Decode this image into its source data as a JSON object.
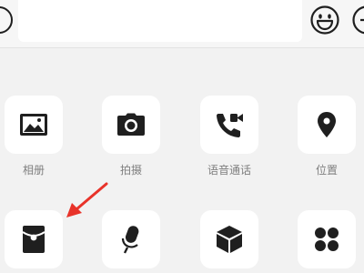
{
  "colors": {
    "panel_bg": "#f2f2f2",
    "tile_bg": "#ffffff",
    "icon": "#1f1f1f",
    "label": "#7f7f7f",
    "arrow": "#e8332a"
  },
  "input_bar": {
    "left_icon": "circle-icon",
    "message_input_value": "",
    "emoji_icon": "emoji-icon",
    "plus_icon": "plus-icon"
  },
  "actions": [
    {
      "icon": "photo-icon",
      "label": "相册"
    },
    {
      "icon": "camera-icon",
      "label": "拍摄"
    },
    {
      "icon": "video-call-icon",
      "label": "语音通话"
    },
    {
      "icon": "location-icon",
      "label": "位置"
    },
    {
      "icon": "red-packet-icon",
      "label": ""
    },
    {
      "icon": "microphone-icon",
      "label": ""
    },
    {
      "icon": "cube-icon",
      "label": ""
    },
    {
      "icon": "more-grid-icon",
      "label": ""
    }
  ],
  "annotation": {
    "icon": "red-arrow-icon",
    "target": "red-packet-icon"
  }
}
